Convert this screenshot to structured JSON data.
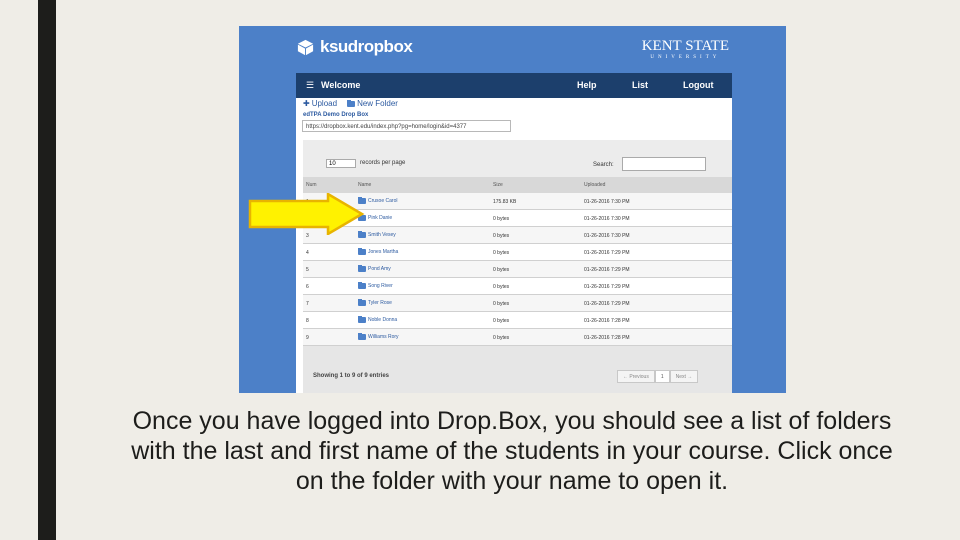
{
  "header": {
    "logo_text": "ksudropbox",
    "university_line1": "KENT STATE",
    "university_line2": "UNIVERSITY"
  },
  "navbar": {
    "welcome": "Welcome",
    "help": "Help",
    "list": "List",
    "logout": "Logout"
  },
  "toolbar": {
    "upload": "Upload",
    "new_folder": "New Folder"
  },
  "dropbox_name": "edTPA Demo Drop Box",
  "url": "https://dropbox.kent.edu/index.php?pg=home/login&id=4377",
  "controls": {
    "per_page_value": "10",
    "per_page_label": "records per page",
    "search_label": "Search:"
  },
  "table": {
    "columns": [
      "Num",
      "Name",
      "Size",
      "Uploaded"
    ],
    "rows": [
      {
        "num": "1",
        "name": "Crusoe Carol",
        "size": "175.83 KB",
        "uploaded": "01-26-2016 7:30 PM"
      },
      {
        "num": "2",
        "name": "Pink Danie",
        "size": "0 bytes",
        "uploaded": "01-26-2016 7:30 PM"
      },
      {
        "num": "3",
        "name": "Smith Vesey",
        "size": "0 bytes",
        "uploaded": "01-26-2016 7:30 PM"
      },
      {
        "num": "4",
        "name": "Jones Martha",
        "size": "0 bytes",
        "uploaded": "01-26-2016 7:29 PM"
      },
      {
        "num": "5",
        "name": "Pond Amy",
        "size": "0 bytes",
        "uploaded": "01-26-2016 7:29 PM"
      },
      {
        "num": "6",
        "name": "Song River",
        "size": "0 bytes",
        "uploaded": "01-26-2016 7:29 PM"
      },
      {
        "num": "7",
        "name": "Tyler Rose",
        "size": "0 bytes",
        "uploaded": "01-26-2016 7:29 PM"
      },
      {
        "num": "8",
        "name": "Noble Donna",
        "size": "0 bytes",
        "uploaded": "01-26-2016 7:28 PM"
      },
      {
        "num": "9",
        "name": "Williams Rory",
        "size": "0 bytes",
        "uploaded": "01-26-2016 7:28 PM"
      }
    ]
  },
  "footer": {
    "showing": "Showing 1 to 9 of 9 entries",
    "previous": "← Previous",
    "page": "1",
    "next": "Next →"
  },
  "caption": "Once you have logged into Drop.Box, you should see a list of folders with the last and first name of the students in your course. Click once on the folder with your name to open it.",
  "colors": {
    "page_bg": "#efede7",
    "accent_bar": "#1d1d1b",
    "screenshot_bg": "#4c80c8",
    "navbar": "#1c3f6c",
    "arrow": "#fff200"
  }
}
